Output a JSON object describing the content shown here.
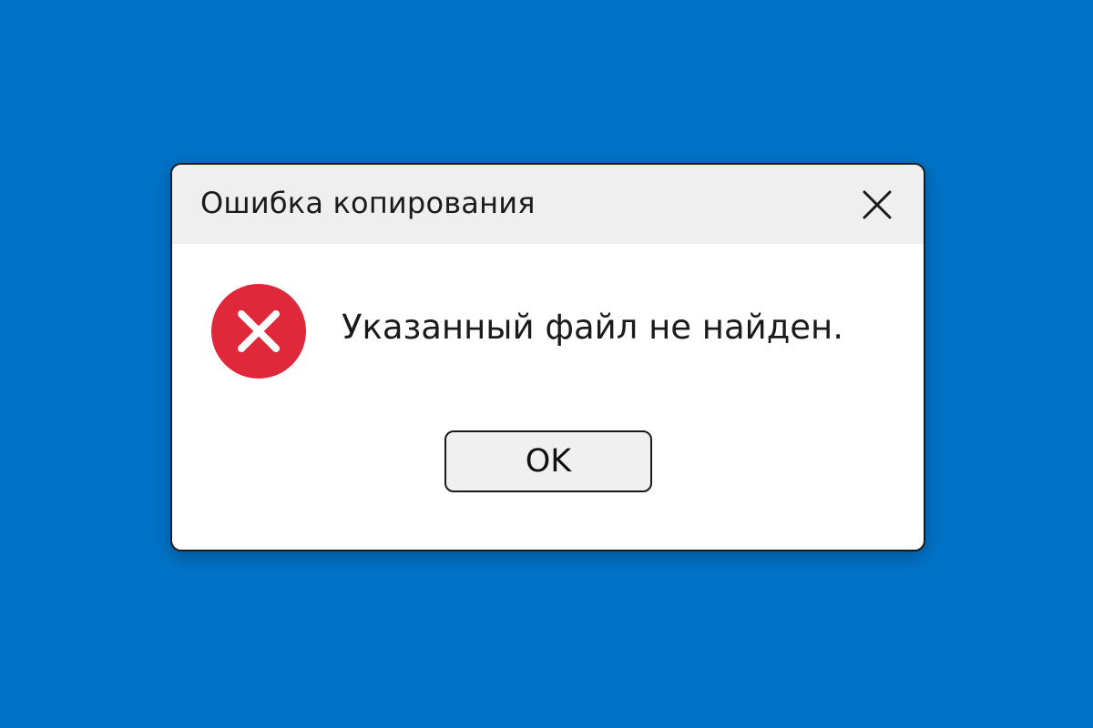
{
  "desktop": {
    "background_color": "#0072c6"
  },
  "dialog": {
    "title": "Ошибка копирования",
    "close_icon": "close-icon",
    "error_icon": "error-x-icon",
    "error_icon_color": "#e0283b",
    "message": "Указанный файл не найден.",
    "ok_label": "OK"
  }
}
